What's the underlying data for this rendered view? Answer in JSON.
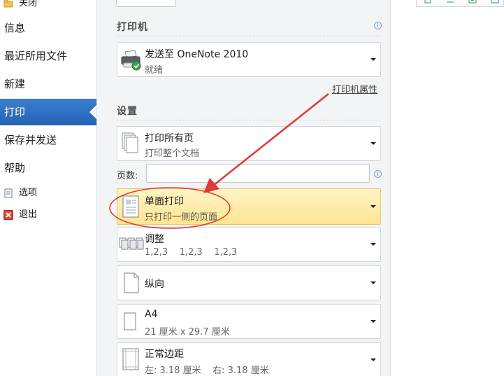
{
  "sidebar": {
    "items": [
      {
        "label": "关闭"
      },
      {
        "label": "信息"
      },
      {
        "label": "最近所用文件"
      },
      {
        "label": "新建"
      },
      {
        "label": "打印"
      },
      {
        "label": "保存并发送"
      },
      {
        "label": "帮助"
      },
      {
        "label": "选项"
      },
      {
        "label": "退出"
      }
    ],
    "selected": "打印"
  },
  "printer": {
    "section_title": "打印机",
    "name": "发送至 OneNote 2010",
    "status": "就绪",
    "properties_link": "打印机属性"
  },
  "settings": {
    "section_title": "设置",
    "pages_label": "页数:",
    "pages_value": "",
    "print_range": {
      "title": "打印所有页",
      "subtitle": "打印整个文档"
    },
    "sides": {
      "title": "单面打印",
      "subtitle": "只打印一侧的页面"
    },
    "collation": {
      "title": "调整",
      "subtitle": "1,2,3    1,2,3    1,2,3"
    },
    "orientation": {
      "title": "纵向"
    },
    "paper": {
      "title": "A4",
      "subtitle": "21 厘米 x 29.7 厘米"
    },
    "margins": {
      "title": "正常边距",
      "subtitle": "左: 3.18 厘米    右: 3.18 厘米"
    }
  },
  "colors": {
    "nav_selected": "#2b6fc0",
    "highlight": "#fde590",
    "annotation_red": "#e03a3a"
  }
}
